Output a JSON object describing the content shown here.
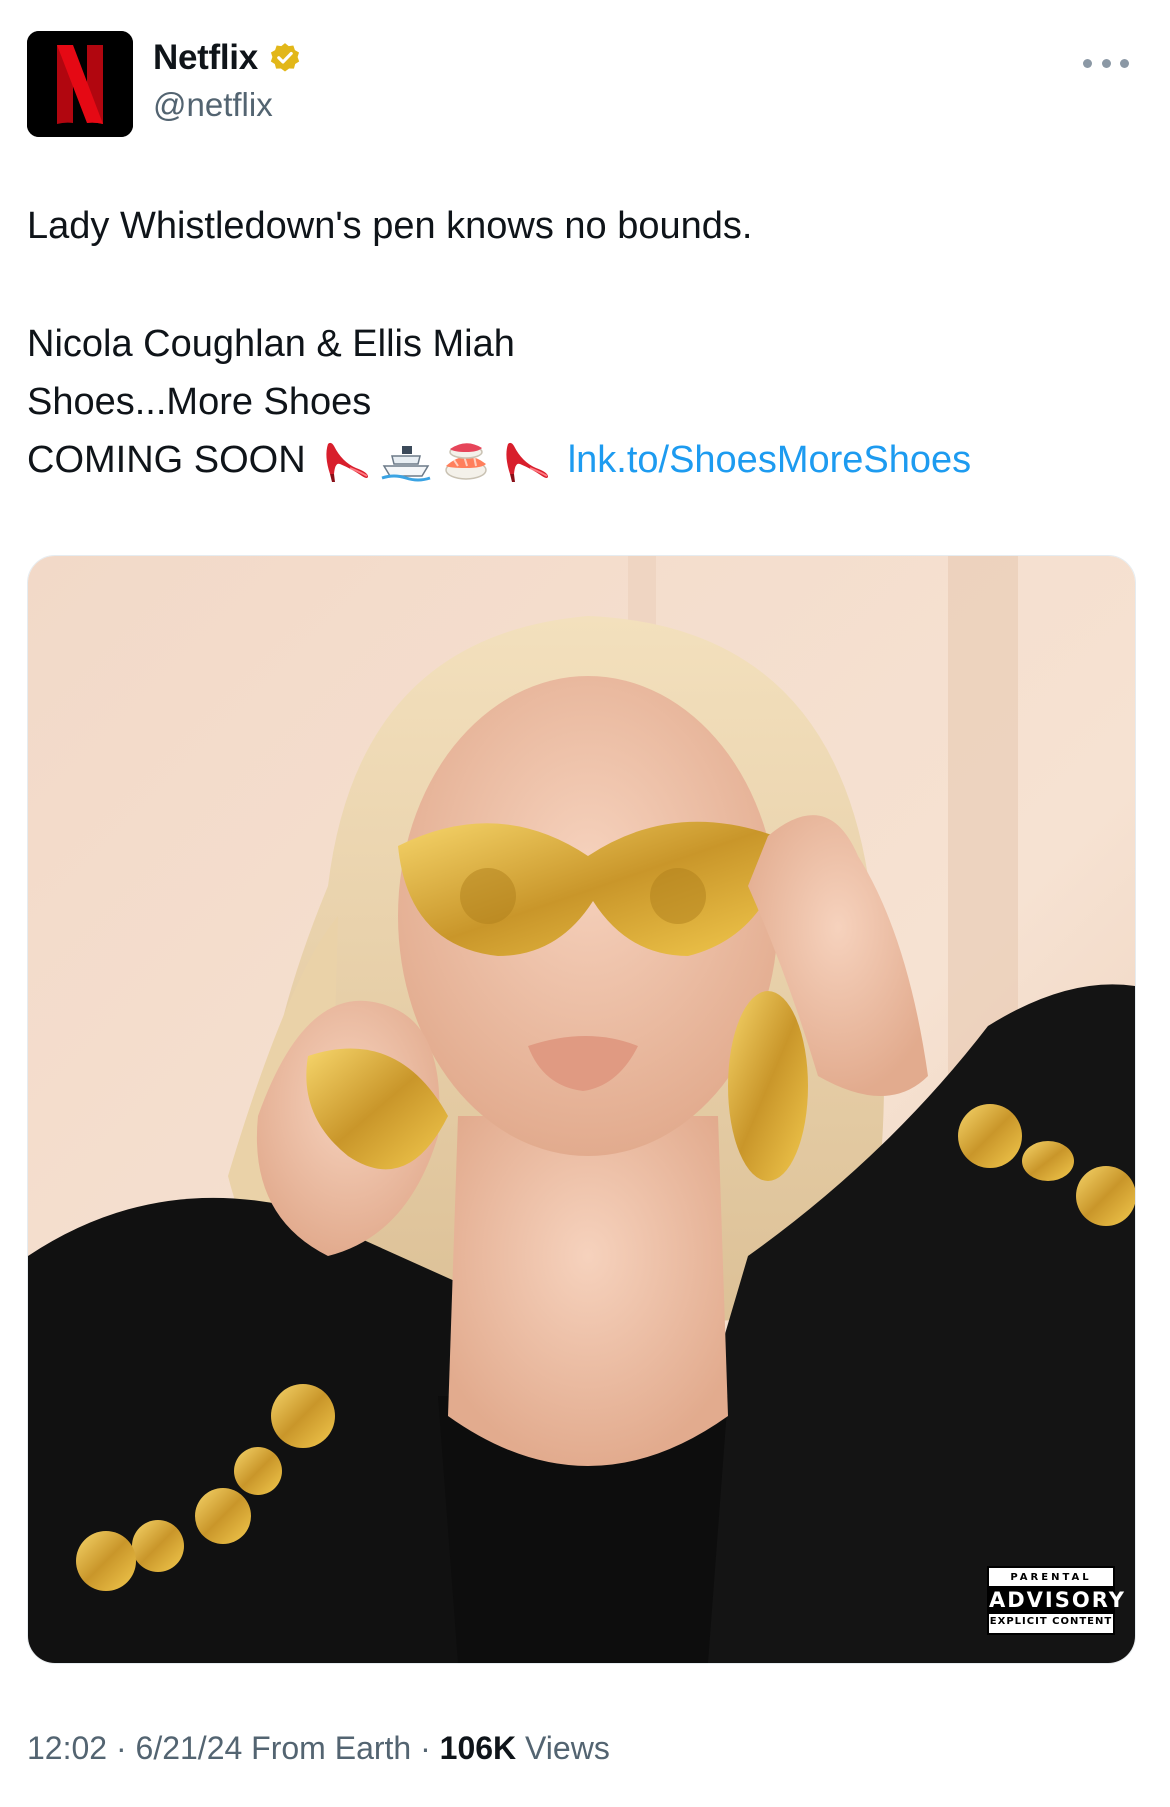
{
  "author": {
    "display_name": "Netflix",
    "handle": "@netflix",
    "verified": true,
    "avatar_letter": "N",
    "brand_color": "#e50914"
  },
  "tweet": {
    "lines": [
      "Lady Whistledown's pen knows no bounds.",
      "Nicola Coughlan & Ellis Miah",
      "Shoes...More Shoes",
      "COMING SOON"
    ],
    "emojis": [
      "high-heel",
      "ship",
      "sushi",
      "high-heel"
    ],
    "link_text": "lnk.to/ShoesMoreShoes",
    "link_color": "#1d9bf0"
  },
  "media": {
    "alt": "Album cover: blonde woman in gold sunglasses and black blazer with gold buttons",
    "advisory_top": "PARENTAL",
    "advisory_mid": "ADVISORY",
    "advisory_bottom": "EXPLICIT CONTENT"
  },
  "meta": {
    "time": "12:02",
    "date": "6/21/24",
    "location": "From Earth",
    "views_count": "106K",
    "views_label": "Views"
  }
}
